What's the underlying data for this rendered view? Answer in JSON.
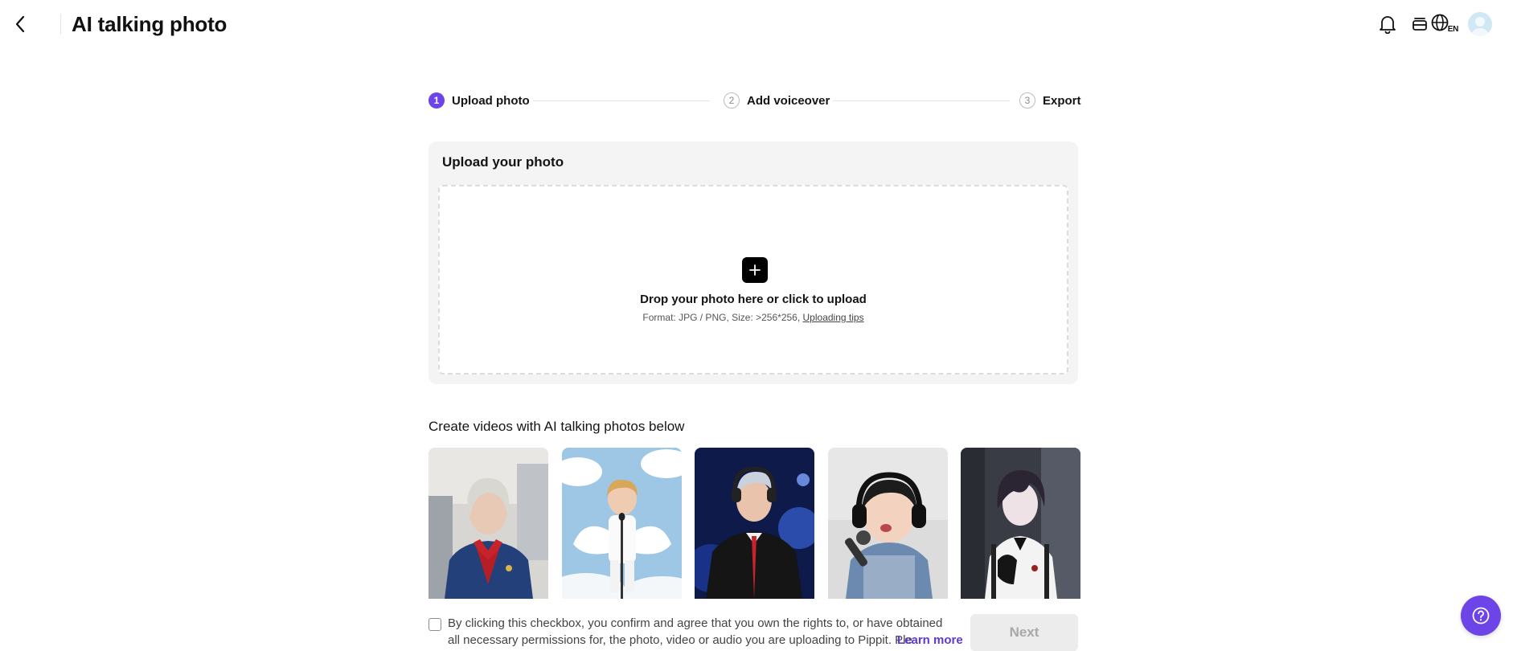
{
  "header": {
    "title": "AI talking photo",
    "back_icon": "chevron-left-icon",
    "notification_icon": "bell-icon",
    "queue_icon": "stack-icon",
    "language_icon": "globe-icon",
    "language_code": "EN"
  },
  "stepper": {
    "steps": [
      {
        "number": "1",
        "label": "Upload photo",
        "active": true
      },
      {
        "number": "2",
        "label": "Add voiceover",
        "active": false
      },
      {
        "number": "3",
        "label": "Export",
        "active": false
      }
    ]
  },
  "upload": {
    "title": "Upload your photo",
    "drop_text": "Drop your photo here or click to upload",
    "format_text": "Format: JPG / PNG, Size: >256*256,",
    "tips_link": "Uploading tips"
  },
  "examples": {
    "title": "Create videos with AI talking photos below",
    "items": [
      {
        "name": "flight-attendant"
      },
      {
        "name": "angel-child"
      },
      {
        "name": "dj-man"
      },
      {
        "name": "baby-singer"
      },
      {
        "name": "anime-boy"
      }
    ]
  },
  "footer": {
    "consent_text": "By clicking this checkbox, you confirm and agree that you own the rights to, or have obtained all necessary permissions for, the photo, video or audio you are uploading to Pippit. Ple",
    "learn_more": "Learn more",
    "next_label": "Next"
  },
  "colors": {
    "accent": "#6c44e8",
    "link": "#5b3ad8",
    "card_bg": "#f4f4f5"
  }
}
